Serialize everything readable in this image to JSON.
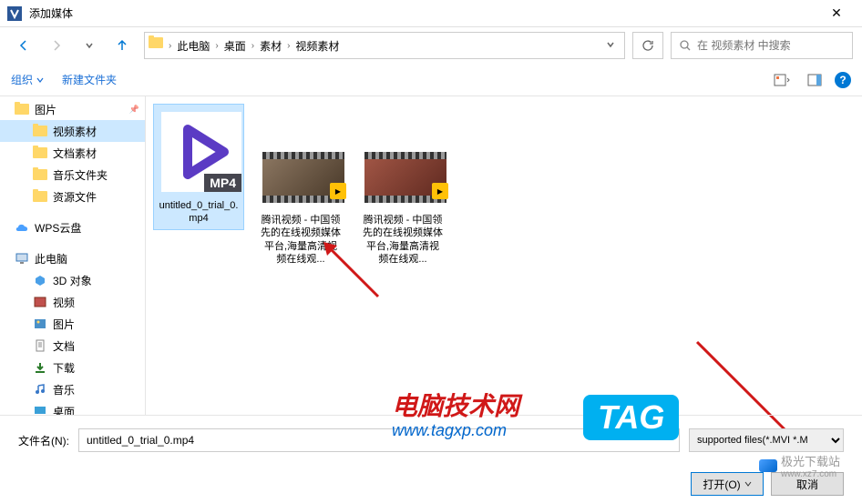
{
  "window": {
    "title": "添加媒体"
  },
  "nav": {
    "breadcrumb": [
      "此电脑",
      "桌面",
      "素材",
      "视频素材"
    ],
    "search_placeholder": "在 视频素材 中搜索"
  },
  "toolbar": {
    "organize": "组织",
    "new_folder": "新建文件夹"
  },
  "sidebar": {
    "items": [
      {
        "label": "图片",
        "type": "folder",
        "pinned": true
      },
      {
        "label": "视频素材",
        "type": "folder",
        "level": 2,
        "selected": true
      },
      {
        "label": "文档素材",
        "type": "folder",
        "level": 2
      },
      {
        "label": "音乐文件夹",
        "type": "folder",
        "level": 2
      },
      {
        "label": "资源文件",
        "type": "folder",
        "level": 2
      }
    ],
    "wps": "WPS云盘",
    "thispc": "此电脑",
    "pc_items": [
      {
        "label": "3D 对象",
        "icon": "3d"
      },
      {
        "label": "视频",
        "icon": "video"
      },
      {
        "label": "图片",
        "icon": "pictures"
      },
      {
        "label": "文档",
        "icon": "docs"
      },
      {
        "label": "下载",
        "icon": "downloads"
      },
      {
        "label": "音乐",
        "icon": "music"
      },
      {
        "label": "桌面",
        "icon": "desktop"
      }
    ]
  },
  "files": [
    {
      "name": "untitled_0_trial_0.mp4",
      "type": "mp4",
      "selected": true
    },
    {
      "name": "腾讯视频 - 中国领先的在线视频媒体平台,海量高清视频在线观...",
      "type": "video1"
    },
    {
      "name": "腾讯视频 - 中国领先的在线视频媒体平台,海量高清视频在线观...",
      "type": "video2"
    }
  ],
  "bottom": {
    "filename_label": "文件名(N):",
    "filename_value": "untitled_0_trial_0.mp4",
    "filetype": "supported files(*.MVI *.M",
    "open": "打开(O)",
    "cancel": "取消"
  },
  "watermark": {
    "cn": "电脑技术网",
    "url": "www.tagxp.com",
    "tag": "TAG",
    "right": "极光下载站",
    "right_url": "www.xz7.com"
  }
}
